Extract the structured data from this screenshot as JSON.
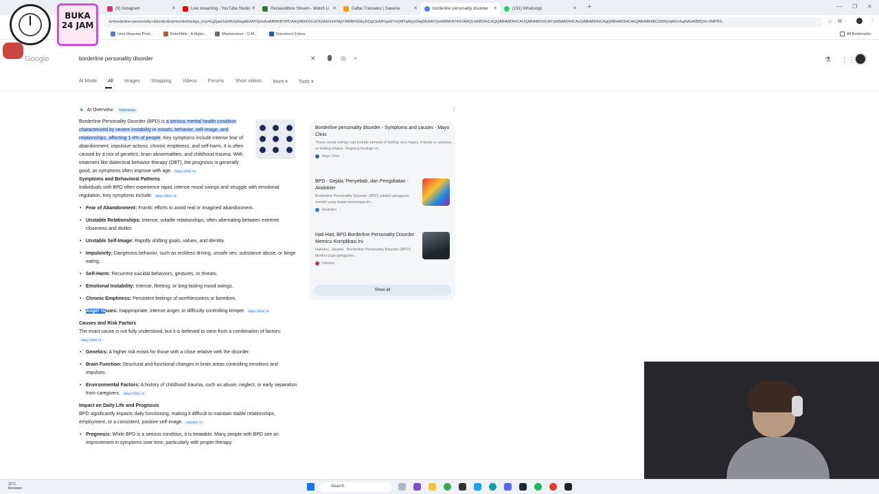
{
  "browser": {
    "tabs": [
      {
        "label": "(9) Instagram",
        "color": "#e1306c"
      },
      {
        "label": "Live streaming - YouTube Studio",
        "color": "#ff0000"
      },
      {
        "label": "Rezaauditore Stream - Watch Li",
        "color": "#2e7d32"
      },
      {
        "label": "Daftar Transaksi | Saweria",
        "color": "#f4a100"
      },
      {
        "label": "borderline personality disorder",
        "color": "#4285f4"
      },
      {
        "label": "(151) WhatsApp",
        "color": "#25d366"
      }
    ],
    "url": "/q=borderline+personality+disorder&oq=borderline&gs_lcrp=EgZjaHJvbWUqDwgAEAAYQxixAxiABBiKBTIPCAAQABhDGLEDGIAEGIoFMgYIARBFGDkyDQgCEAAYgwEYsQMYgAQyDAgDEAAYQxiABBiKBTIHCAMQLhiABDIHCAQQABiABDIHCAUQABiABDIHCAYQABiABDIHCAcQABiABDIHCAgQABiABDIHCAkQABiABNIBCDI5NjJqMGo5qAIAsAIB8QXn-6MFf59..."
  },
  "bookmarks": [
    {
      "label": "Uma Musume Prett...",
      "color": "#4a7bd0"
    },
    {
      "label": "Rule34dle - A Highe...",
      "color": "#c05a2a"
    },
    {
      "label": "Maintenance - G-M...",
      "color": "#6b6b6b"
    },
    {
      "label": "Document 9.docx",
      "color": "#1a5dc8"
    }
  ],
  "all_bookmarks_label": "All Bookmarks",
  "overlay": {
    "badge_line1": "BUKA",
    "badge_line2": "24 JAM"
  },
  "search": {
    "query": "borderline personality disorder",
    "tabs": [
      "AI Mode",
      "All",
      "Images",
      "Shopping",
      "Videos",
      "Forums",
      "Short videos",
      "More",
      "Tools"
    ]
  },
  "ai_overview": {
    "title": "AI Overview",
    "language_chip": "Indonesia",
    "intro_pre": "Borderline Personality Disorder (BPD) is ",
    "intro_hl": "a serious mental health condition characterized by severe instability in moods, behavior, self-image, and relationships, affecting 1-4% of people",
    "intro_post": ". Key symptoms include intense fear of abandonment, impulsive actions, chronic emptiness, and self-harm. It is often caused by a mix of genetics, brain abnormalities, and childhood trauma. With treatment like dialectical behavior therapy (DBT), the prognosis is generally good, as symptoms often improve with age.",
    "intro_cite": "Mayo Clinic +5",
    "symptoms_heading": "Symptoms and Behavioral Patterns",
    "symptoms_intro": "Individuals with BPD often experience rapid, intense mood swings and struggle with emotional regulation. Key symptoms include:",
    "symptoms_cite": "Mayo Clinic +4",
    "symptoms": [
      {
        "term": "Fear of Abandonment:",
        "desc": "Frantic efforts to avoid real or imagined abandonment."
      },
      {
        "term": "Unstable Relationships:",
        "desc": "Intense, volatile relationships, often alternating between extreme closeness and dislike."
      },
      {
        "term": "Unstable Self-Image:",
        "desc": "Rapidly shifting goals, values, and identity."
      },
      {
        "term": "Impulsivity:",
        "desc": "Dangerous behavior, such as reckless driving, unsafe sex, substance abuse, or binge eating."
      },
      {
        "term": "Self-Harm:",
        "desc": "Recurrent suicidal behaviors, gestures, or threats."
      },
      {
        "term": "Emotional Instability:",
        "desc": "Intense, fleeting, or long-lasting mood swings."
      },
      {
        "term": "Chronic Emptiness:",
        "desc": "Persistent feelings of worthlessness or boredom."
      }
    ],
    "anger_term_selected": "Anger Is",
    "anger_term_rest": "sues:",
    "anger_desc": "Inappropriate, intense anger, or difficulty controlling temper.",
    "anger_cite": "Mayo Clinic +5",
    "causes_heading": "Causes and Risk Factors",
    "causes_intro": "The exact cause is not fully understood, but it is believed to stem from a combination of factors:",
    "causes_cite": "Mayo Clinic +2",
    "causes": [
      {
        "term": "Genetics:",
        "desc": "A higher risk exists for those with a close relative with the disorder.",
        "cite": ""
      },
      {
        "term": "Brain Function:",
        "desc": "Structural and functional changes in brain areas controlling emotions and impulses.",
        "cite": ""
      },
      {
        "term": "Environmental Factors:",
        "desc": "A history of childhood trauma, such as abuse, neglect, or early separation from caregivers.",
        "cite": "Mayo Clinic +4"
      }
    ],
    "impact_heading": "Impact on Daily Life and Prognosis",
    "impact_text": "BPD significantly impacts daily functioning, making it difficult to maintain stable relationships, employment, or a consistent, positive self-image.",
    "impact_cite": "Halodoc +1",
    "prognosis_term": "Prognosis:",
    "prognosis_desc": "While BPD is a serious condition, it is treatable. Many people with BPD see an improvement in symptoms over time, particularly with proper therapy."
  },
  "sources": [
    {
      "title": "Borderline personality disorder - Symptoms and causes - Mayo Clinic",
      "snippet": "These mood swings can include periods of feeling very happy, irritable or anxious, or feeling shame. Ongoing feelings of...",
      "site": "Mayo Clinic",
      "color": "#3567a8"
    },
    {
      "title": "BPD - Gejala, Penyebab, dan Pengobatan - Alodokter",
      "snippet": "Borderline Personality Disorder (BPD) adalah gangguan mental yang dapat memengaruhi...",
      "site": "Alodokter",
      "color": "#1e88e5"
    },
    {
      "title": "Hati-Hati, BPD Borderline Personality Disorder Memicu Komplikasi Ini",
      "snippet": "Halodoc, Jakarta - Borderline Personality Disorder (BPD) disebut juga gangguan...",
      "site": "Halodoc",
      "color": "#e0245e"
    }
  ],
  "show_all_label": "Show all",
  "taskbar": {
    "temperature": "22°C",
    "weather": "Berawan",
    "search_label": "Search"
  }
}
